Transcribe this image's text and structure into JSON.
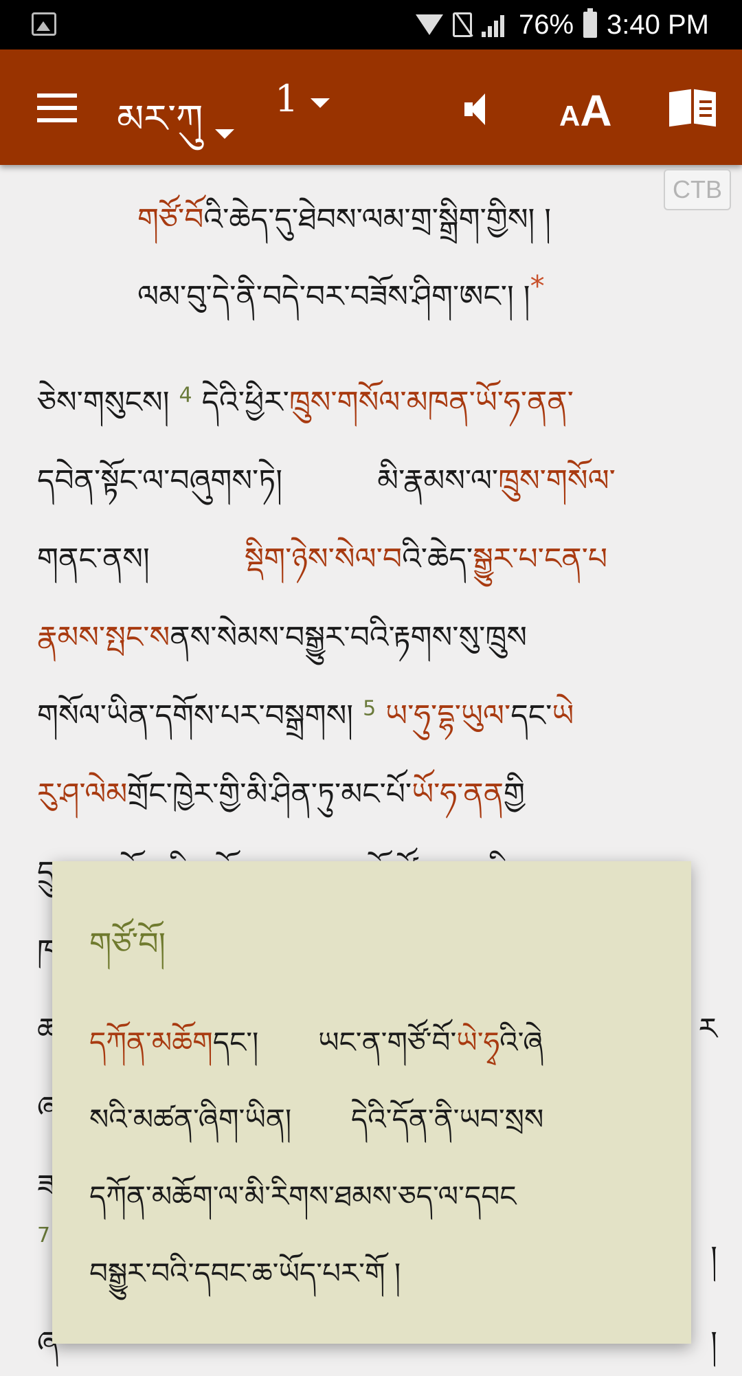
{
  "status_bar": {
    "battery": "76%",
    "time": "3:40 PM",
    "icons": [
      "gallery-icon",
      "wifi-icon",
      "no-sim-icon",
      "signal-icon",
      "battery-icon"
    ]
  },
  "toolbar": {
    "background": "#993300",
    "book": "མར་ཀུ",
    "chapter": "1",
    "font_small": "A",
    "font_large": "A"
  },
  "version_badge": "CTB",
  "text": {
    "line1": {
      "red": "གཙོ་བོ",
      "black": "འི་ཆེད་དུ་ཐེབས་ལམ་གྲ་སྒྲིག་གྱིས། །"
    },
    "line2": {
      "black": "ལམ་བུ་དེ་ནི་བདེ་བར་བཟོས་ཤིག་ཨང་། །",
      "star": "*"
    },
    "line3": {
      "a": "ཅེས་གསུངས།",
      "verse": "4",
      "b": "དེའི་ཕྱིར་",
      "red": "ཁྲུས་གསོལ་མཁན་ཡོ་ཧ་ནན་"
    },
    "line4": {
      "a": "དབེན་སྟོང་ལ་བཞུགས་ཏེ།",
      "b": "མི་རྣམས་ལ་",
      "red": "ཁྲུས་གསོལ་"
    },
    "line5": {
      "a": "གནང་ནས།",
      "red1": "སྡིག་ཉེས་སེལ་བ",
      "b": "འི་ཆེད་",
      "red2": "སྒྱུར་པ་ངན་པ"
    },
    "line6": {
      "red": "རྣམས་སྤང་ས",
      "a": "ནས་སེམས་བསྒྱུར་བའི་རྟགས་སུ་ཁྲུས"
    },
    "line7": {
      "a": "གསོལ་ཡིན་དགོས་པར་བསྒྲགས།",
      "verse": "5",
      "red": "ཡ་ཧུ་དྷ་ཡུལ་",
      "b": "དང་",
      "red2": "ཡེ"
    },
    "line8": {
      "red": "རུ་ཤ་ལེམ",
      "a": "གྲོང་ཁྱེར་གྱི་མི་ཤིན་ཏུ་མང་པོ་",
      "red2": "ཡོ་ཧ་ནན",
      "b": "གྱི"
    },
    "line9": {
      "a": "དྲུང་དུ་འགོ་བཞིན་ཡོང་བས།",
      "b": "ཁོ་ཚོས་རང་གི་ལས་ངན"
    },
    "line10": {
      "a": "ཁ"
    },
    "line11": {
      "a": "ཚ",
      "b": "ར"
    },
    "line12": {
      "a": "ཞ"
    },
    "line13": {
      "a": "ཟ"
    },
    "line14": {
      "verse": "7",
      "b": "།"
    },
    "line15": {
      "a": "ཞ",
      "b": "།"
    }
  },
  "popup": {
    "title": "གཙོ་བོ།",
    "l1": {
      "red1": "དཀོན་མཆོག",
      "a": "དང་།",
      "b": "ཡང་ན་གཙོ་བོ་",
      "red2": "ཡེ་ཧྭ",
      "c": "འི་ཞེ"
    },
    "l2": {
      "a": "སའི་མཚན་ཞིག་ཡིན།",
      "b": "དེའི་དོན་ནི་ཡབ་སྲས"
    },
    "l3": {
      "a": "དཀོན་མཆོག་ལ་མི་རིགས་ཐམས་ཅད་ལ་དབང"
    },
    "l4": {
      "a": "བསྒྱུར་བའི་དབང་ཆ་ཡོད་པར་གོ །"
    }
  }
}
